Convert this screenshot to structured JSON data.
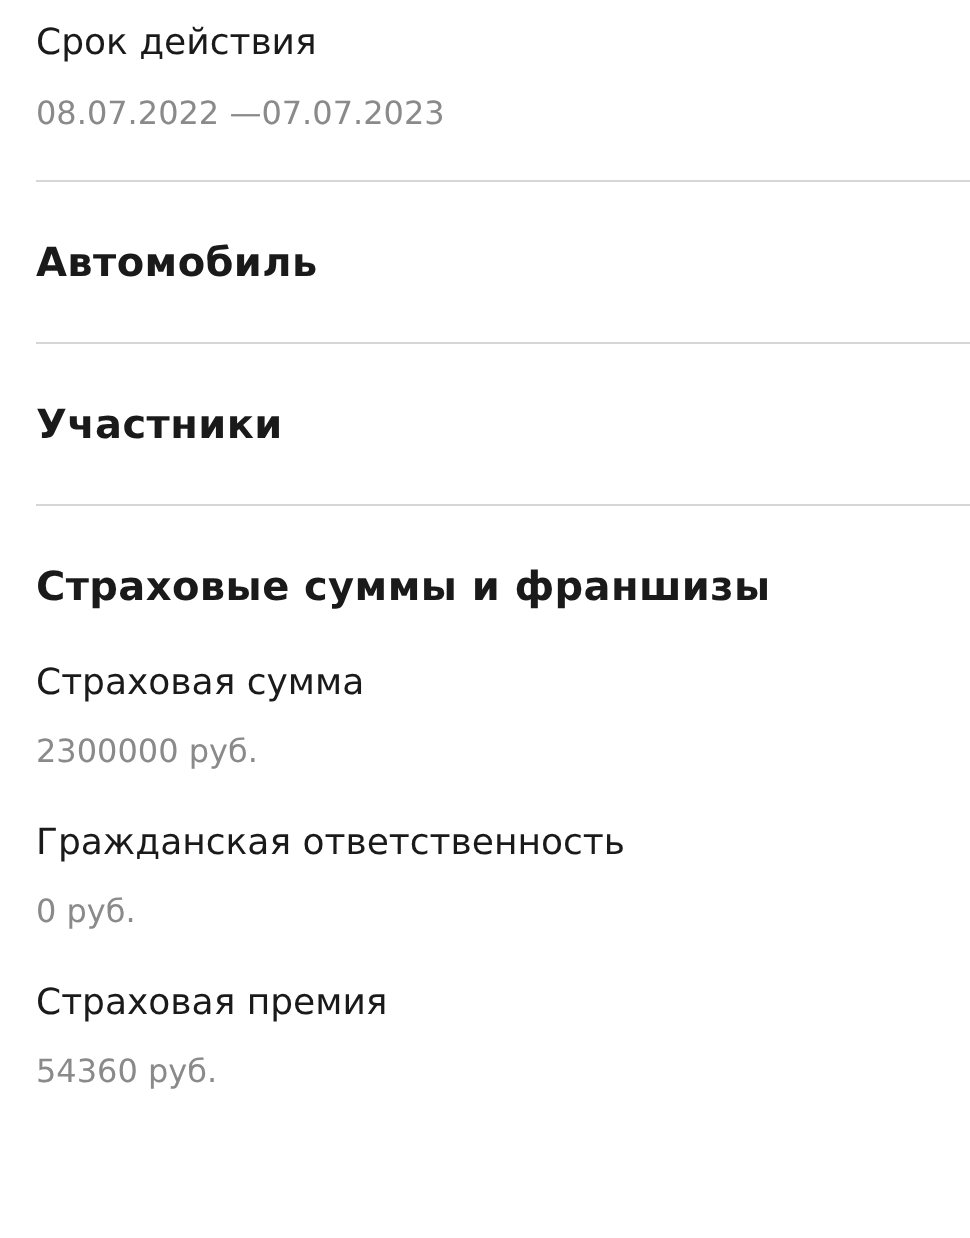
{
  "validity": {
    "label": "Срок действия",
    "value": "08.07.2022 —07.07.2023"
  },
  "sections": [
    {
      "title": "Автомобиль"
    },
    {
      "title": "Участники"
    }
  ],
  "amounts": {
    "title": "Страховые суммы и франшизы",
    "items": [
      {
        "label": "Страховая сумма",
        "value": "2300000 руб."
      },
      {
        "label": "Гражданская ответственность",
        "value": "0 руб."
      },
      {
        "label": "Страховая премия",
        "value": "54360 руб."
      }
    ]
  }
}
